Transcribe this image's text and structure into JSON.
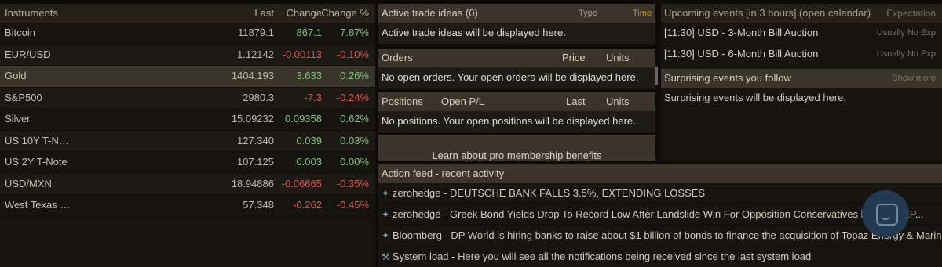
{
  "instruments": {
    "headers": {
      "name": "Instruments",
      "last": "Last",
      "change": "Change",
      "change_pct": "Change %"
    },
    "rows": [
      {
        "name": "Bitcoin",
        "last": "11879.1",
        "change": "867.1",
        "pct": "7.87%",
        "dir": "pos"
      },
      {
        "name": "EUR/USD",
        "last": "1.12142",
        "change": "-0.00113",
        "pct": "-0.10%",
        "dir": "neg"
      },
      {
        "name": "Gold",
        "last": "1404.193",
        "change": "3.633",
        "pct": "0.26%",
        "dir": "pos"
      },
      {
        "name": "S&P500",
        "last": "2980.3",
        "change": "-7.3",
        "pct": "-0.24%",
        "dir": "neg"
      },
      {
        "name": "Silver",
        "last": "15.09232",
        "change": "0.09358",
        "pct": "0.62%",
        "dir": "pos"
      },
      {
        "name": "US 10Y T-N…",
        "last": "127.340",
        "change": "0.039",
        "pct": "0.03%",
        "dir": "pos"
      },
      {
        "name": "US 2Y T-Note",
        "last": "107.125",
        "change": "0.003",
        "pct": "0.00%",
        "dir": "pos"
      },
      {
        "name": "USD/MXN",
        "last": "18.94886",
        "change": "-0.06665",
        "pct": "-0.35%",
        "dir": "neg"
      },
      {
        "name": "West Texas …",
        "last": "57.348",
        "change": "-0.262",
        "pct": "-0.45%",
        "dir": "neg"
      }
    ]
  },
  "ideas": {
    "title": "Active trade ideas (0)",
    "type": "Type",
    "time": "Time",
    "empty": "Active trade ideas will be displayed here."
  },
  "orders": {
    "title": "Orders",
    "price": "Price",
    "units": "Units",
    "empty": "No open orders. Your open orders will be displayed here."
  },
  "positions": {
    "title": "Positions",
    "pl": "Open P/L",
    "last": "Last",
    "units": "Units",
    "empty": "No positions. Your open positions will be displayed here."
  },
  "promo": {
    "text": "Learn about pro membership benefits"
  },
  "events": {
    "title": "Upcoming events [in 3 hours] (open calendar)",
    "expectation": "Expectation",
    "rows": [
      {
        "label": "[11:30] USD - 3-Month Bill Auction",
        "tag": "Usually No Exp"
      },
      {
        "label": "[11:30] USD - 6-Month Bill Auction",
        "tag": "Usually No Exp"
      }
    ]
  },
  "surprise": {
    "title": "Surprising events you follow",
    "show_more": "Show more",
    "empty": "Surprising events will be displayed here."
  },
  "feed": {
    "title": "Action feed - recent activity",
    "items": [
      {
        "text": "zerohedge - DEUTSCHE BANK FALLS 3.5%, EXTENDING LOSSES",
        "icon": "twitter-icon"
      },
      {
        "text": "zerohedge - Greek Bond Yields Drop To Record Low After Landslide Win For Opposition Conservatives https://... XP...",
        "icon": "twitter-icon"
      },
      {
        "text": "Bloomberg - DP World is hiring banks to raise about $1 billion of bonds to finance the acquisition of Topaz Energy & Marine...",
        "icon": "twitter-icon"
      },
      {
        "text": "System load - Here you will see all the notifications being received since the last system load",
        "icon": "tools-icon"
      }
    ]
  },
  "colors": {
    "positive": "#7fc27a",
    "negative": "#d9534f",
    "header": "#3a342b",
    "chat": "#243a52"
  }
}
